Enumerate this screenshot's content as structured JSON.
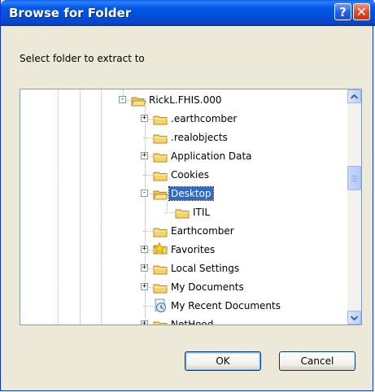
{
  "window": {
    "title": "Browse for Folder",
    "help_glyph": "?",
    "close_glyph": "✕"
  },
  "prompt": "Select folder to extract to",
  "tree": {
    "items": [
      {
        "label": "RickL.FHIS.000",
        "expander": "−",
        "icon": "folder-open-icon"
      },
      {
        "label": ".earthcomber",
        "expander": "+",
        "icon": "folder-icon"
      },
      {
        "label": ".realobjects",
        "expander": "",
        "icon": "folder-icon"
      },
      {
        "label": "Application Data",
        "expander": "+",
        "icon": "folder-icon"
      },
      {
        "label": "Cookies",
        "expander": "",
        "icon": "folder-icon"
      },
      {
        "label": "Desktop",
        "expander": "−",
        "icon": "folder-open-icon",
        "selected": true
      },
      {
        "label": "ITIL",
        "expander": "",
        "icon": "folder-icon"
      },
      {
        "label": "Earthcomber",
        "expander": "",
        "icon": "folder-icon"
      },
      {
        "label": "Favorites",
        "expander": "+",
        "icon": "star-folder-icon"
      },
      {
        "label": "Local Settings",
        "expander": "+",
        "icon": "folder-icon"
      },
      {
        "label": "My Documents",
        "expander": "+",
        "icon": "folder-icon"
      },
      {
        "label": "My Recent Documents",
        "expander": "",
        "icon": "recent-documents-icon"
      },
      {
        "label": "NetHood",
        "expander": "+",
        "icon": "folder-icon"
      }
    ]
  },
  "buttons": {
    "ok": "OK",
    "cancel": "Cancel"
  },
  "colors": {
    "title_bar": "#0054e3",
    "selection": "#316ac5",
    "dialog_bg": "#ece9d8"
  }
}
